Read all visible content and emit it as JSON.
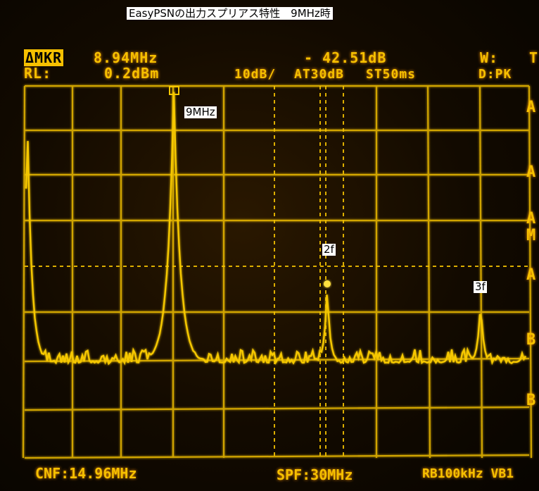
{
  "caption": "EasyPSNの出力スプリアス特性　9MHz時",
  "header": {
    "marker_mode": "ΔMKR",
    "marker_freq": "8.94MHz",
    "marker_level": "- 42.51dB",
    "wf_label": "W:",
    "rl_label": "RL:",
    "rl_value": "0.2dBm",
    "scale": "10dB/",
    "attenuation": "AT30dB",
    "sweep_time": "ST50ms",
    "detector": "D:PK",
    "right_edge": "T"
  },
  "footer": {
    "center_freq": "CNF:14.96MHz",
    "span": "SPF:30MHz",
    "rbw_vbw": "RB100kHz VB1"
  },
  "side_indicators": [
    "A",
    "A",
    "A",
    "M",
    "A",
    "B",
    "B"
  ],
  "annotations": {
    "fundamental": "9MHz",
    "second_harmonic": "2f",
    "third_harmonic": "3f"
  },
  "marker_symbol": "◻",
  "colors": {
    "trace": "#f6c800",
    "grid": "#f2c000",
    "background": "#120a00",
    "label_bg": "#ffffff"
  }
}
